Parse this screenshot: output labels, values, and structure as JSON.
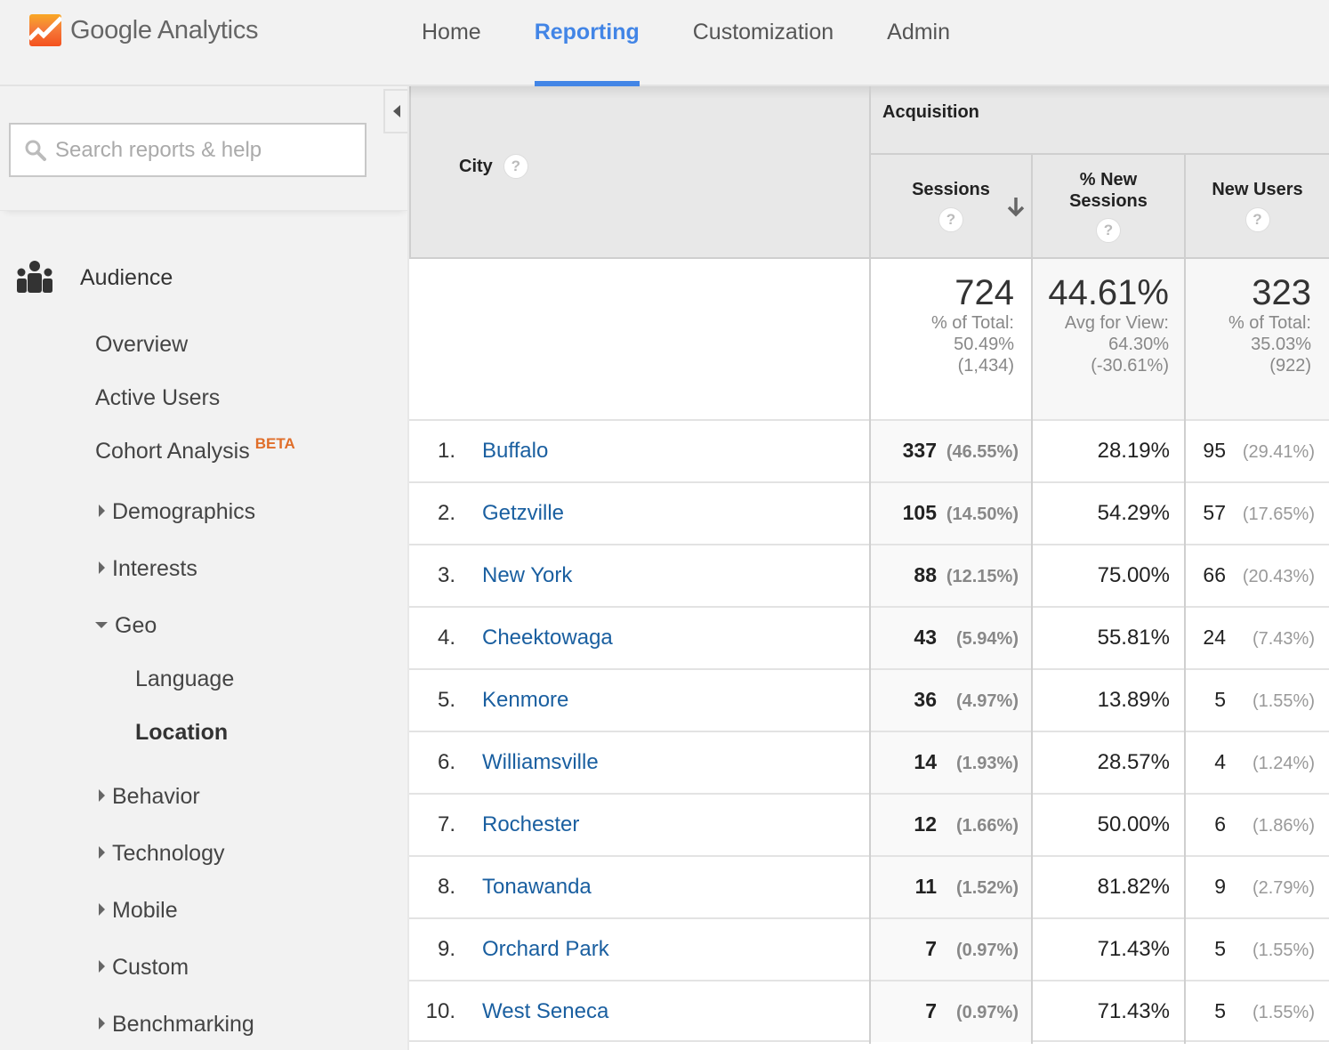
{
  "app": {
    "brand": "Google Analytics",
    "accent_color": "#4285e6",
    "link_color": "#1a5fa0",
    "beta_color": "#e06e2a"
  },
  "topnav": {
    "items": [
      {
        "label": "Home",
        "active": false
      },
      {
        "label": "Reporting",
        "active": true
      },
      {
        "label": "Customization",
        "active": false
      },
      {
        "label": "Admin",
        "active": false
      }
    ]
  },
  "sidebar": {
    "search_placeholder": "Search reports & help",
    "search_icon": "search-icon",
    "collapse_icon": "triangle-left-icon",
    "section": {
      "label": "Audience",
      "icon": "audience-icon"
    },
    "items": [
      {
        "label": "Overview"
      },
      {
        "label": "Active Users"
      },
      {
        "label": "Cohort Analysis",
        "badge": "BETA"
      },
      {
        "label": "Demographics",
        "expandable": true,
        "expanded": false
      },
      {
        "label": "Interests",
        "expandable": true,
        "expanded": false
      },
      {
        "label": "Geo",
        "expandable": true,
        "expanded": true
      },
      {
        "label": "Language",
        "child": true
      },
      {
        "label": "Location",
        "child": true,
        "selected": true
      },
      {
        "label": "Behavior",
        "expandable": true,
        "expanded": false
      },
      {
        "label": "Technology",
        "expandable": true,
        "expanded": false
      },
      {
        "label": "Mobile",
        "expandable": true,
        "expanded": false
      },
      {
        "label": "Custom",
        "expandable": true,
        "expanded": false
      },
      {
        "label": "Benchmarking",
        "expandable": true,
        "expanded": false
      }
    ]
  },
  "table": {
    "dimension_header": "City",
    "group_header": "Acquisition",
    "help_glyph": "?",
    "columns": [
      {
        "label_line1": "Sessions",
        "label_line2": "",
        "sorted": "desc"
      },
      {
        "label_line1": "% New",
        "label_line2": "Sessions",
        "sorted": null
      },
      {
        "label_line1": "New Users",
        "label_line2": "",
        "sorted": null
      }
    ],
    "summary": {
      "sessions": {
        "value": "724",
        "line1": "% of Total:",
        "line2": "50.49%",
        "line3": "(1,434)"
      },
      "new_sessions": {
        "value": "44.61%",
        "line1": "Avg for View:",
        "line2": "64.30%",
        "line3": "(-30.61%)"
      },
      "new_users": {
        "value": "323",
        "line1": "% of Total:",
        "line2": "35.03%",
        "line3": "(922)"
      }
    },
    "rows": [
      {
        "rank": "1.",
        "city": "Buffalo",
        "sessions": "337",
        "sessions_pct": "(46.55%)",
        "new_sessions": "28.19%",
        "new_users": "95",
        "new_users_pct": "(29.41%)"
      },
      {
        "rank": "2.",
        "city": "Getzville",
        "sessions": "105",
        "sessions_pct": "(14.50%)",
        "new_sessions": "54.29%",
        "new_users": "57",
        "new_users_pct": "(17.65%)"
      },
      {
        "rank": "3.",
        "city": "New York",
        "sessions": "88",
        "sessions_pct": "(12.15%)",
        "new_sessions": "75.00%",
        "new_users": "66",
        "new_users_pct": "(20.43%)"
      },
      {
        "rank": "4.",
        "city": "Cheektowaga",
        "sessions": "43",
        "sessions_pct": "(5.94%)",
        "new_sessions": "55.81%",
        "new_users": "24",
        "new_users_pct": "(7.43%)"
      },
      {
        "rank": "5.",
        "city": "Kenmore",
        "sessions": "36",
        "sessions_pct": "(4.97%)",
        "new_sessions": "13.89%",
        "new_users": "5",
        "new_users_pct": "(1.55%)"
      },
      {
        "rank": "6.",
        "city": "Williamsville",
        "sessions": "14",
        "sessions_pct": "(1.93%)",
        "new_sessions": "28.57%",
        "new_users": "4",
        "new_users_pct": "(1.24%)"
      },
      {
        "rank": "7.",
        "city": "Rochester",
        "sessions": "12",
        "sessions_pct": "(1.66%)",
        "new_sessions": "50.00%",
        "new_users": "6",
        "new_users_pct": "(1.86%)"
      },
      {
        "rank": "8.",
        "city": "Tonawanda",
        "sessions": "11",
        "sessions_pct": "(1.52%)",
        "new_sessions": "81.82%",
        "new_users": "9",
        "new_users_pct": "(2.79%)"
      },
      {
        "rank": "9.",
        "city": "Orchard Park",
        "sessions": "7",
        "sessions_pct": "(0.97%)",
        "new_sessions": "71.43%",
        "new_users": "5",
        "new_users_pct": "(1.55%)"
      },
      {
        "rank": "10.",
        "city": "West Seneca",
        "sessions": "7",
        "sessions_pct": "(0.97%)",
        "new_sessions": "71.43%",
        "new_users": "5",
        "new_users_pct": "(1.55%)"
      }
    ]
  }
}
